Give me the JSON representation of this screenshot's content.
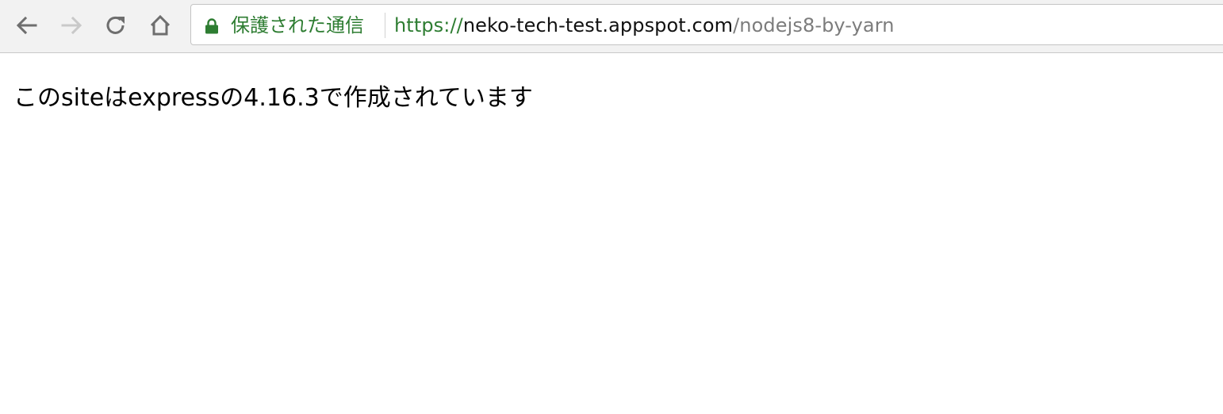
{
  "browser": {
    "nav": {
      "back_icon": "arrow-left-icon",
      "forward_icon": "arrow-right-icon",
      "reload_icon": "reload-icon",
      "home_icon": "home-icon"
    },
    "omnibox": {
      "lock_icon": "lock-icon",
      "security_label": "保護された通信",
      "url_scheme": "https://",
      "url_host": "neko-tech-test.appspot.com",
      "url_path": "/nodejs8-by-yarn"
    },
    "colors": {
      "secure_green": "#2e7d32",
      "toolbar_bg": "#f2f2f2",
      "path_gray": "#7c7c7c"
    }
  },
  "page": {
    "message": "このsiteはexpressの4.16.3で作成されています"
  }
}
